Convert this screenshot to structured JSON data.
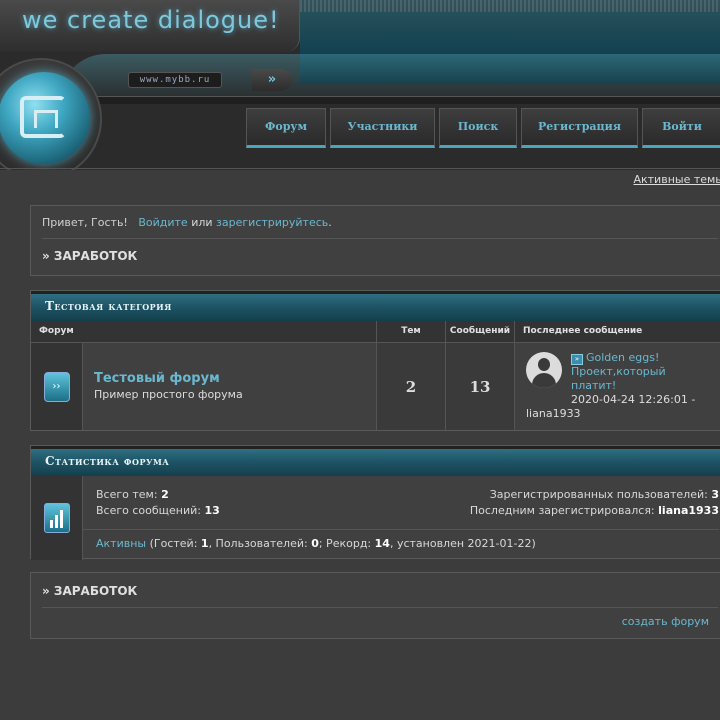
{
  "header": {
    "logo_text": "we create dialogue!",
    "url_text": "www.mybb.ru",
    "url_arrow": "»"
  },
  "nav": [
    {
      "label": "Форум"
    },
    {
      "label": "Участники"
    },
    {
      "label": "Поиск"
    },
    {
      "label": "Регистрация"
    },
    {
      "label": "Войти"
    }
  ],
  "subbar": {
    "active_topics": "Активные темы"
  },
  "welcome": {
    "greeting": "Привет, Гость!",
    "login": "Войдите",
    "or": "или",
    "register": "зарегистрируйтесь",
    "period": ".",
    "heading": "» ЗАРАБОТОК"
  },
  "category": {
    "title": "Тестовая категория",
    "columns": {
      "forum": "Форум",
      "topics": "Тем",
      "posts": "Сообщений",
      "last": "Последнее сообщение"
    },
    "forum": {
      "name": "Тестовый форум",
      "description": "Пример простого форума",
      "topics": "2",
      "posts": "13",
      "last_post_title_1": "Golden eggs!",
      "last_post_title_2": "Проект,который",
      "last_post_title_3": "платит!",
      "last_post_date": "2020-04-24 12:26:01 -",
      "last_post_user": "liana1933"
    }
  },
  "stats": {
    "title": "Статистика форума",
    "total_topics_label": "Всего тем:",
    "total_topics": "2",
    "total_posts_label": "Всего сообщений:",
    "total_posts": "13",
    "registered_label": "Зарегистрированных пользователей:",
    "registered": "3",
    "last_registered_label": "Последним зарегистрировался:",
    "last_registered": "liana1933",
    "active_link": "Активны",
    "guests_label": "(Гостей:",
    "guests": "1",
    "users_label": ", Пользователей:",
    "users": "0",
    "record_label": "; Рекорд:",
    "record": "14",
    "record_date": ", установлен 2021-01-22)"
  },
  "footer_note": {
    "heading": "» ЗАРАБОТОК",
    "create_forum": "создать форум"
  }
}
